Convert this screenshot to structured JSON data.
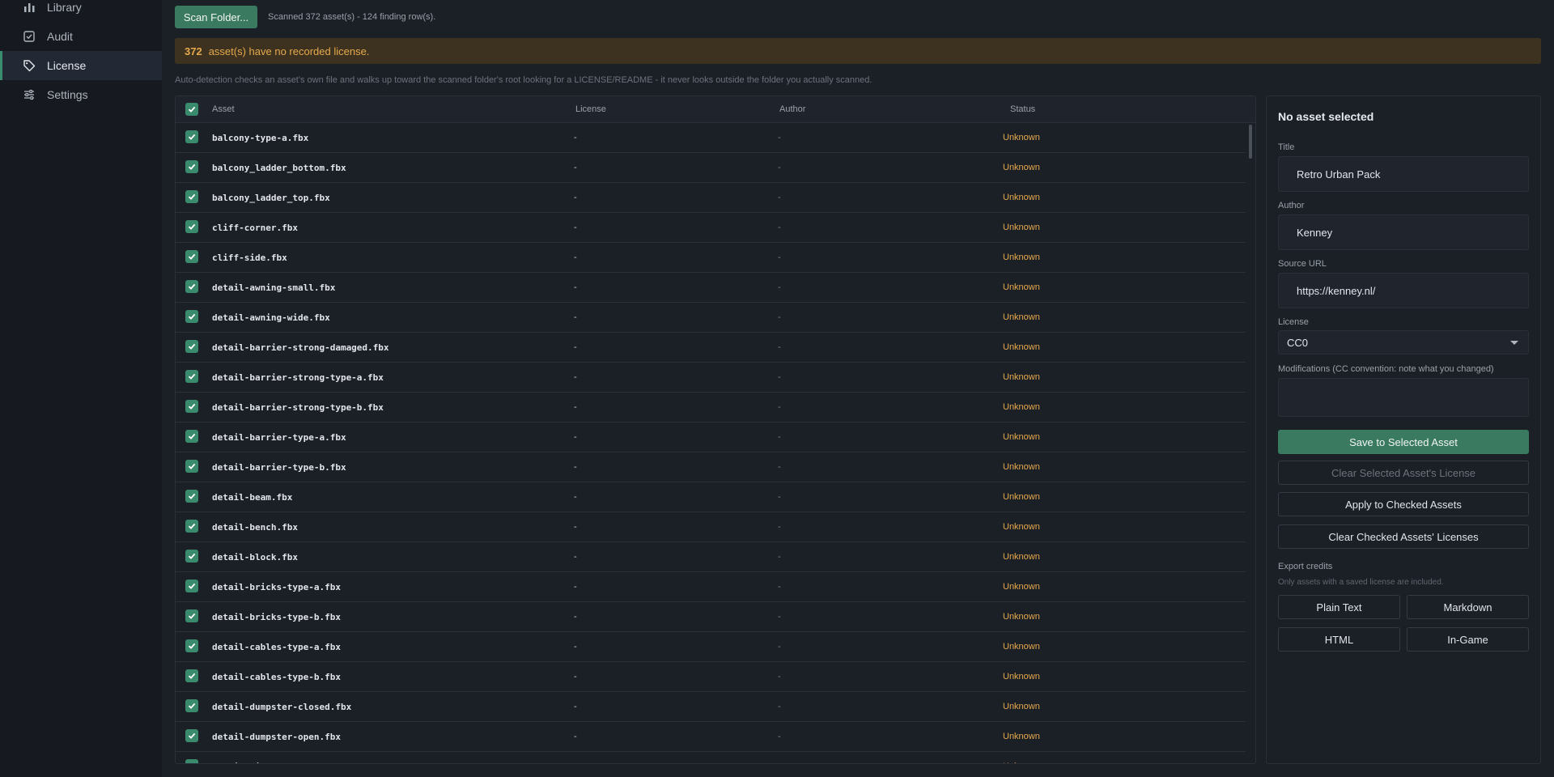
{
  "sidebar": {
    "items": [
      {
        "label": "Library",
        "icon": "bar-chart-icon",
        "active": false
      },
      {
        "label": "Audit",
        "icon": "checkbox-icon",
        "active": false
      },
      {
        "label": "License",
        "icon": "tag-icon",
        "active": true
      },
      {
        "label": "Settings",
        "icon": "sliders-icon",
        "active": false
      }
    ]
  },
  "toolbar": {
    "scan_label": "Scan Folder...",
    "scan_status": "Scanned 372 asset(s) - 124 finding row(s)."
  },
  "banner": {
    "count": "372",
    "text": "asset(s) have no recorded license."
  },
  "hint": "Auto-detection checks an asset's own file and walks up toward the scanned folder's root looking for a LICENSE/README - it never looks outside the folder you actually scanned.",
  "table": {
    "headers": {
      "asset": "Asset",
      "license": "License",
      "author": "Author",
      "status": "Status"
    },
    "rows": [
      {
        "asset": "balcony-type-a.fbx",
        "license": "-",
        "author": "-",
        "status": "Unknown"
      },
      {
        "asset": "balcony_ladder_bottom.fbx",
        "license": "-",
        "author": "-",
        "status": "Unknown"
      },
      {
        "asset": "balcony_ladder_top.fbx",
        "license": "-",
        "author": "-",
        "status": "Unknown"
      },
      {
        "asset": "cliff-corner.fbx",
        "license": "-",
        "author": "-",
        "status": "Unknown"
      },
      {
        "asset": "cliff-side.fbx",
        "license": "-",
        "author": "-",
        "status": "Unknown"
      },
      {
        "asset": "detail-awning-small.fbx",
        "license": "-",
        "author": "-",
        "status": "Unknown"
      },
      {
        "asset": "detail-awning-wide.fbx",
        "license": "-",
        "author": "-",
        "status": "Unknown"
      },
      {
        "asset": "detail-barrier-strong-damaged.fbx",
        "license": "-",
        "author": "-",
        "status": "Unknown"
      },
      {
        "asset": "detail-barrier-strong-type-a.fbx",
        "license": "-",
        "author": "-",
        "status": "Unknown"
      },
      {
        "asset": "detail-barrier-strong-type-b.fbx",
        "license": "-",
        "author": "-",
        "status": "Unknown"
      },
      {
        "asset": "detail-barrier-type-a.fbx",
        "license": "-",
        "author": "-",
        "status": "Unknown"
      },
      {
        "asset": "detail-barrier-type-b.fbx",
        "license": "-",
        "author": "-",
        "status": "Unknown"
      },
      {
        "asset": "detail-beam.fbx",
        "license": "-",
        "author": "-",
        "status": "Unknown"
      },
      {
        "asset": "detail-bench.fbx",
        "license": "-",
        "author": "-",
        "status": "Unknown"
      },
      {
        "asset": "detail-block.fbx",
        "license": "-",
        "author": "-",
        "status": "Unknown"
      },
      {
        "asset": "detail-bricks-type-a.fbx",
        "license": "-",
        "author": "-",
        "status": "Unknown"
      },
      {
        "asset": "detail-bricks-type-b.fbx",
        "license": "-",
        "author": "-",
        "status": "Unknown"
      },
      {
        "asset": "detail-cables-type-a.fbx",
        "license": "-",
        "author": "-",
        "status": "Unknown"
      },
      {
        "asset": "detail-cables-type-b.fbx",
        "license": "-",
        "author": "-",
        "status": "Unknown"
      },
      {
        "asset": "detail-dumpster-closed.fbx",
        "license": "-",
        "author": "-",
        "status": "Unknown"
      },
      {
        "asset": "detail-dumpster-open.fbx",
        "license": "-",
        "author": "-",
        "status": "Unknown"
      },
      {
        "asset": "detail-light-double.fbx",
        "license": "-",
        "author": "-",
        "status": "Unknown"
      }
    ]
  },
  "panel": {
    "title": "No asset selected",
    "title_label": "Title",
    "title_value": "Retro Urban Pack",
    "author_label": "Author",
    "author_value": "Kenney",
    "source_label": "Source URL",
    "source_value": "https://kenney.nl/",
    "license_label": "License",
    "license_value": "CC0",
    "mods_label": "Modifications (CC convention: note what you changed)",
    "save_label": "Save to Selected Asset",
    "clear_selected_label": "Clear Selected Asset's License",
    "apply_label": "Apply to Checked Assets",
    "clear_checked_label": "Clear Checked Assets' Licenses",
    "export_label": "Export credits",
    "export_note": "Only assets with a saved license are included.",
    "export_buttons": [
      "Plain Text",
      "Markdown",
      "HTML",
      "In-Game"
    ]
  },
  "colors": {
    "accent": "#3a7a61",
    "warning": "#e6a94d",
    "background": "#1b1f26"
  }
}
